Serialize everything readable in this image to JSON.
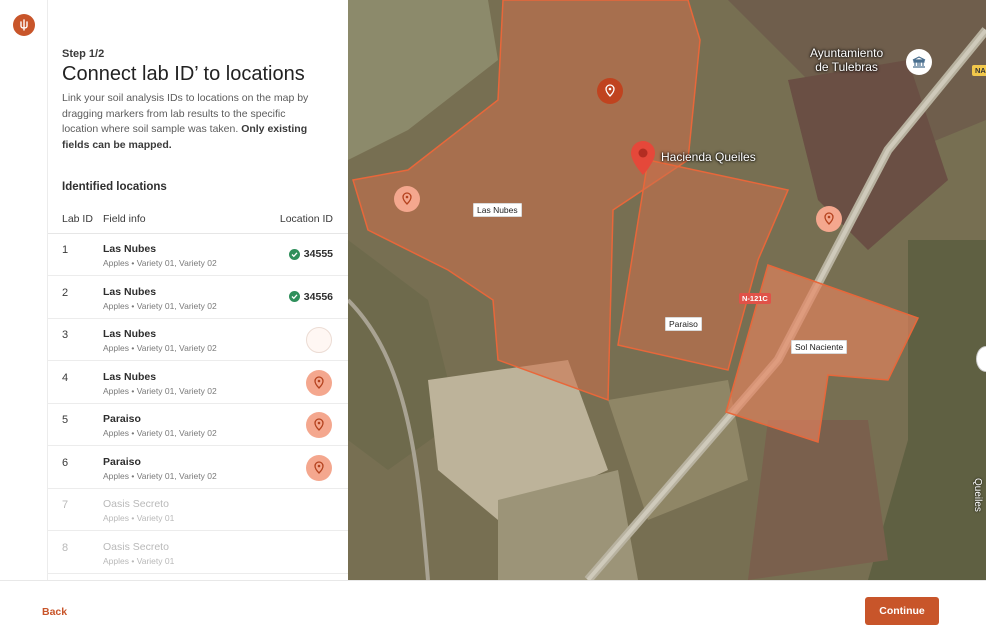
{
  "app": {
    "logo_icon": "brand-logo-icon",
    "accent": "#c8552a"
  },
  "panel": {
    "step": "Step 1/2",
    "title": "Connect lab ID’ to locations",
    "description": "Link your soil analysis IDs to locations on the map by dragging markers from lab results to the specific location where soil sample was taken.",
    "description_bold": "Only existing fields can be mapped.",
    "section_title": "Identified locations",
    "columns": {
      "lab_id": "Lab ID",
      "field_info": "Field info",
      "location_id": "Location ID"
    },
    "rows": [
      {
        "id": "1",
        "name": "Las Nubes",
        "sub": "Apples • Variety 01, Variety 02",
        "location": "34555",
        "state": "assigned"
      },
      {
        "id": "2",
        "name": "Las Nubes",
        "sub": "Apples • Variety 01, Variety 02",
        "location": "34556",
        "state": "assigned"
      },
      {
        "id": "3",
        "name": "Las Nubes",
        "sub": "Apples • Variety 01, Variety 02",
        "location": "",
        "state": "empty"
      },
      {
        "id": "4",
        "name": "Las Nubes",
        "sub": "Apples • Variety 01, Variety 02",
        "location": "",
        "state": "marker"
      },
      {
        "id": "5",
        "name": "Paraiso",
        "sub": "Apples • Variety 01, Variety 02",
        "location": "",
        "state": "marker"
      },
      {
        "id": "6",
        "name": "Paraiso",
        "sub": "Apples • Variety 01, Variety 02",
        "location": "",
        "state": "marker"
      },
      {
        "id": "7",
        "name": "Oasis Secreto",
        "sub": "Apples • Variety 01",
        "location": "",
        "state": "disabled"
      },
      {
        "id": "8",
        "name": "Oasis Secreto",
        "sub": "Apples • Variety 01",
        "location": "",
        "state": "disabled"
      }
    ]
  },
  "map": {
    "field_labels": [
      "Las Nubes",
      "Paraiso",
      "Sol Naciente"
    ],
    "place_hacienda": "Hacienda Queiles",
    "place_ayuntamiento_line1": "Ayuntamiento",
    "place_ayuntamiento_line2": "de Tulebras",
    "road_tag": "N-121C",
    "edge_badge": "NA",
    "edge_text": "Queiles"
  },
  "footer": {
    "back": "Back",
    "continue": "Continue"
  }
}
